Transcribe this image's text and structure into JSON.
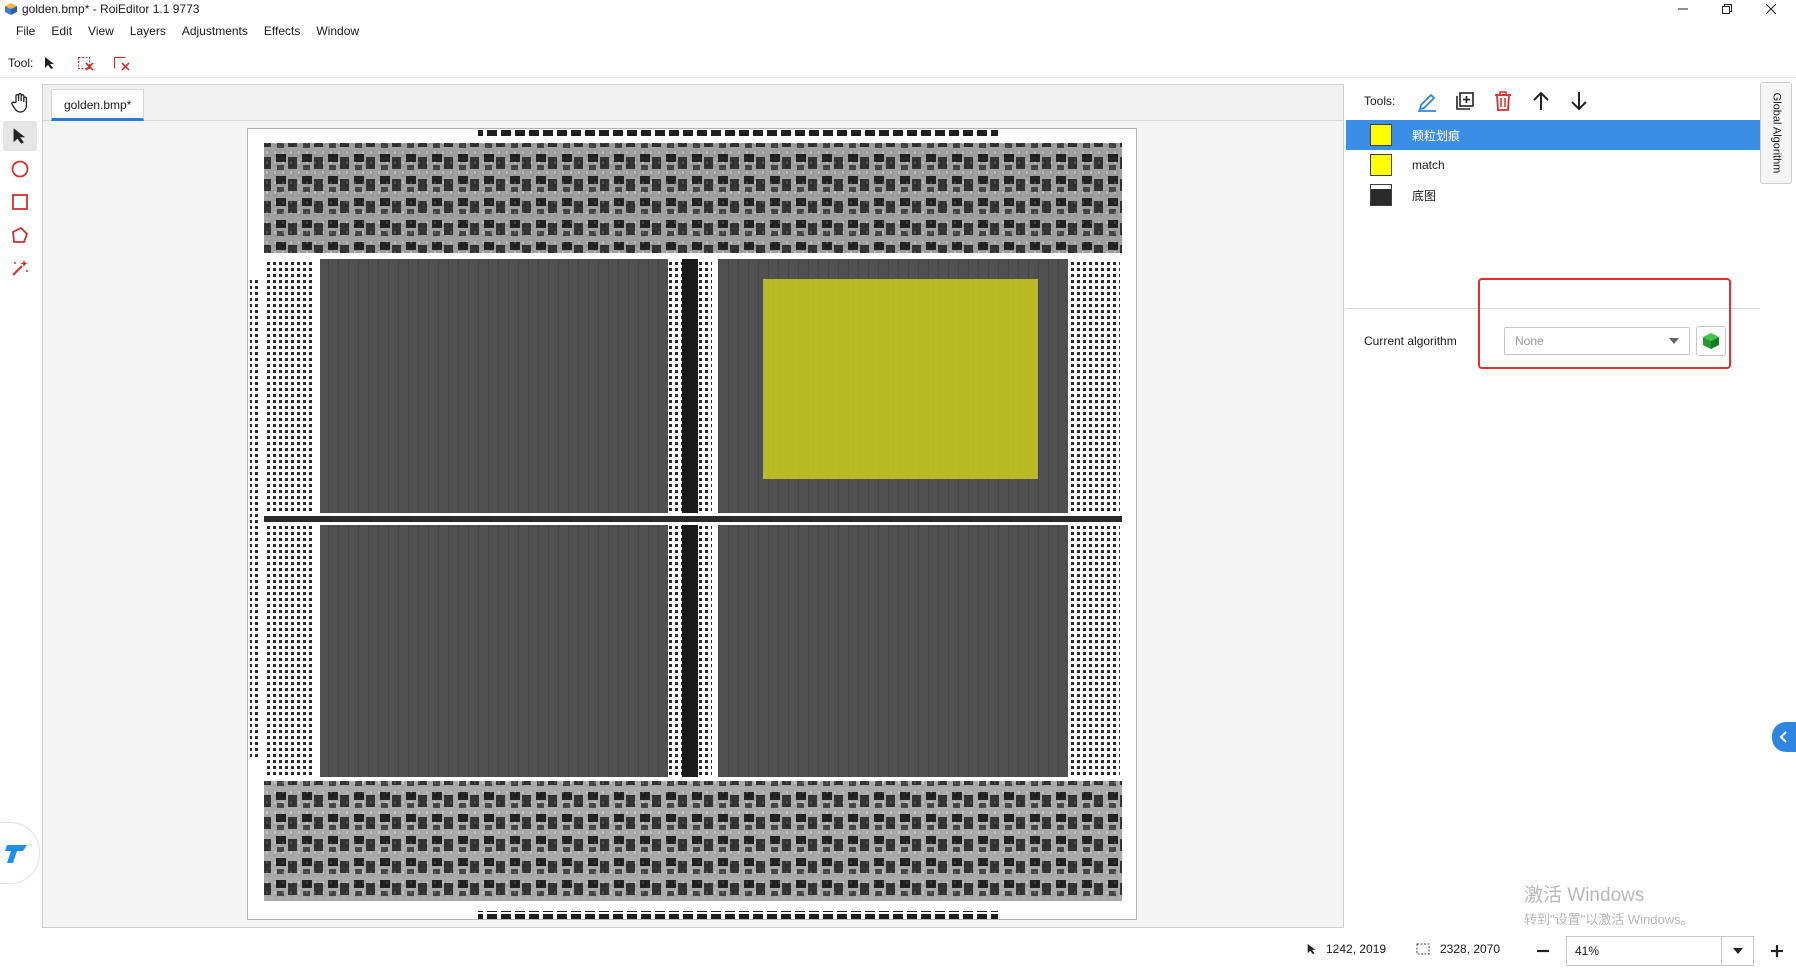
{
  "window": {
    "title": "golden.bmp* - RoiEditor 1.1 9773"
  },
  "menu": [
    "File",
    "Edit",
    "View",
    "Layers",
    "Adjustments",
    "Effects",
    "Window"
  ],
  "toolbar": {
    "label": "Tool:",
    "icons": [
      "pointer-icon",
      "delete-selection-icon",
      "delete-all-icon"
    ]
  },
  "left_tools": [
    "hand-icon",
    "pointer-icon",
    "circle-icon",
    "rectangle-icon",
    "polygon-icon",
    "magic-wand-icon"
  ],
  "document": {
    "tab_label": "golden.bmp*"
  },
  "right_panel": {
    "tools_label": "Tools:",
    "tool_icons": [
      "edit-icon",
      "add-layer-icon",
      "delete-icon",
      "arrow-up-icon",
      "arrow-down-icon"
    ],
    "layers": [
      {
        "name": "颗粒划痕",
        "swatch": "#ffff00",
        "selected": true
      },
      {
        "name": "match",
        "swatch": "#ffff00",
        "selected": false
      },
      {
        "name": "底图",
        "swatch": "image",
        "selected": false
      }
    ],
    "algorithm_label": "Current algorithm",
    "algorithm_value": "None"
  },
  "side_tab": {
    "label": "Global Algorithm"
  },
  "status": {
    "cursor": "1242, 2019",
    "size": "2328, 2070",
    "zoom": "41%"
  },
  "watermark": {
    "line1": "激活 Windows",
    "line2": "转到\"设置\"以激活 Windows。"
  },
  "colors": {
    "accent": "#3a8ee6",
    "highlight": "#e03030",
    "roi": "#c8c81e"
  }
}
